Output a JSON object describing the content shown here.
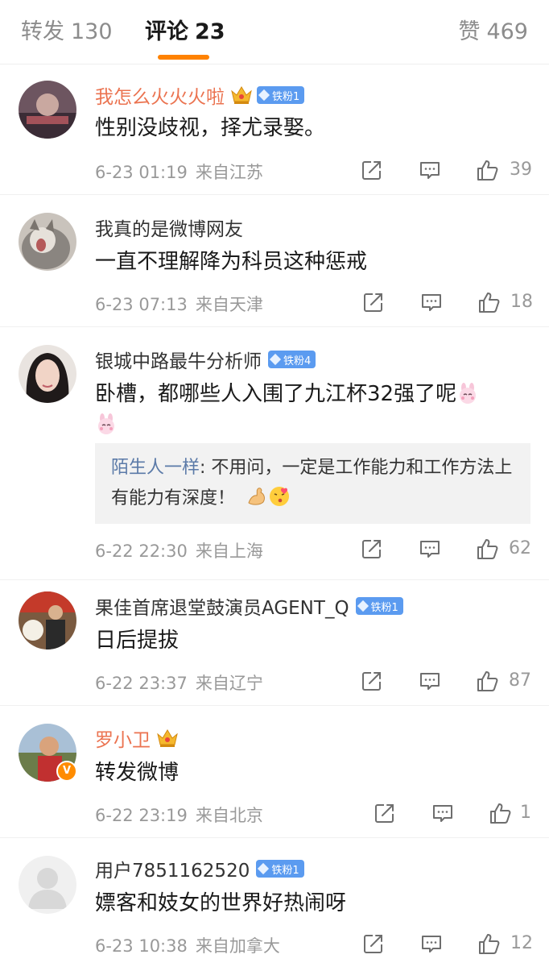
{
  "tabs": [
    {
      "label": "转发",
      "count": "130"
    },
    {
      "label": "评论",
      "count": "23"
    },
    {
      "label": "赞",
      "count": "469"
    }
  ],
  "colors": {
    "accent": "#ff8200",
    "username_vip": "#eb7350",
    "fan_badge": "#5b9bf0",
    "reply_user": "#5b7aa8"
  },
  "comments": [
    {
      "username": "我怎么火火火啦",
      "badge": "铁粉1",
      "text": "性别没歧视，择尤录娶。",
      "time": "6-23 01:19",
      "location": "来自江苏",
      "likes": "39"
    },
    {
      "username": "我真的是微博网友",
      "text": "一直不理解降为科员这种惩戒",
      "time": "6-23 07:13",
      "location": "来自天津",
      "likes": "18"
    },
    {
      "username": "银城中路最牛分析师",
      "badge": "铁粉4",
      "text": "卧槽，都哪些人入围了九江杯32强了呢",
      "reply_user": "陌生人一样",
      "reply_text": ": 不用问，一定是工作能力和工作方法上有能力有深度！",
      "time": "6-22 22:30",
      "location": "来自上海",
      "likes": "62"
    },
    {
      "username": "果佳首席退堂鼓演员AGENT_Q",
      "badge": "铁粉1",
      "text": "日后提拔",
      "time": "6-22 23:37",
      "location": "来自辽宁",
      "likes": "87"
    },
    {
      "username": "罗小卫",
      "text": "转发微博",
      "time": "6-22 23:19",
      "location": "来自北京",
      "likes": "1"
    },
    {
      "username": "用户7851162520",
      "badge": "铁粉1",
      "text": "嫖客和妓女的世界好热闹呀",
      "time": "6-23 10:38",
      "location": "来自加拿大",
      "likes": "12"
    }
  ],
  "icons": [
    "repost-icon",
    "comment-icon",
    "like-icon",
    "crown-icon",
    "verified-badge-icon",
    "rabbit-emoji-icon",
    "strong-arm-emoji-icon",
    "kiss-emoji-icon"
  ]
}
